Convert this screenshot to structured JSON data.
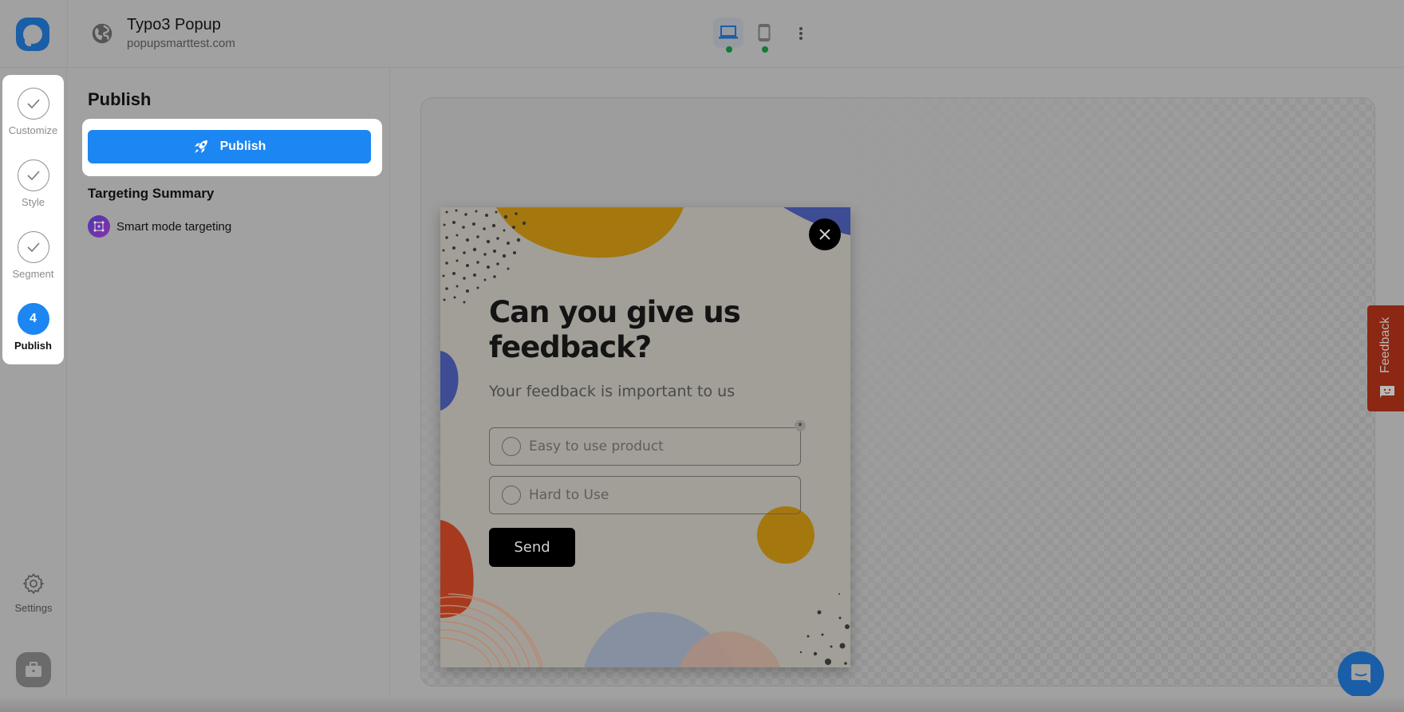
{
  "header": {
    "title": "Typo3 Popup",
    "url": "popupsmarttest.com",
    "devices": [
      {
        "name": "desktop",
        "active": true,
        "status": "enabled"
      },
      {
        "name": "mobile",
        "active": false,
        "status": "enabled"
      }
    ]
  },
  "steps": [
    {
      "label": "Customize",
      "state": "completed"
    },
    {
      "label": "Style",
      "state": "completed"
    },
    {
      "label": "Segment",
      "state": "completed"
    },
    {
      "label": "Publish",
      "state": "active",
      "number": "4"
    }
  ],
  "rail": {
    "settings_label": "Settings"
  },
  "panel": {
    "title": "Publish",
    "publish_button": "Publish",
    "targeting_title": "Targeting Summary",
    "targeting_items": [
      {
        "label": "Smart mode targeting",
        "icon": "smart-mode-icon"
      }
    ]
  },
  "popup": {
    "heading": "Can you give us feedback?",
    "subheading": "Your feedback is important to us",
    "required_mark": "*",
    "options": [
      {
        "label": "Easy to use product",
        "selected": false
      },
      {
        "label": "Hard to Use",
        "selected": false
      }
    ],
    "send_label": "Send"
  },
  "feedback_tab": {
    "label": "Feedback"
  },
  "colors": {
    "accent": "#1c86f2",
    "brand": "#1a5ea8",
    "status_online": "#137a3a",
    "feedback_tab": "#8b2712"
  }
}
